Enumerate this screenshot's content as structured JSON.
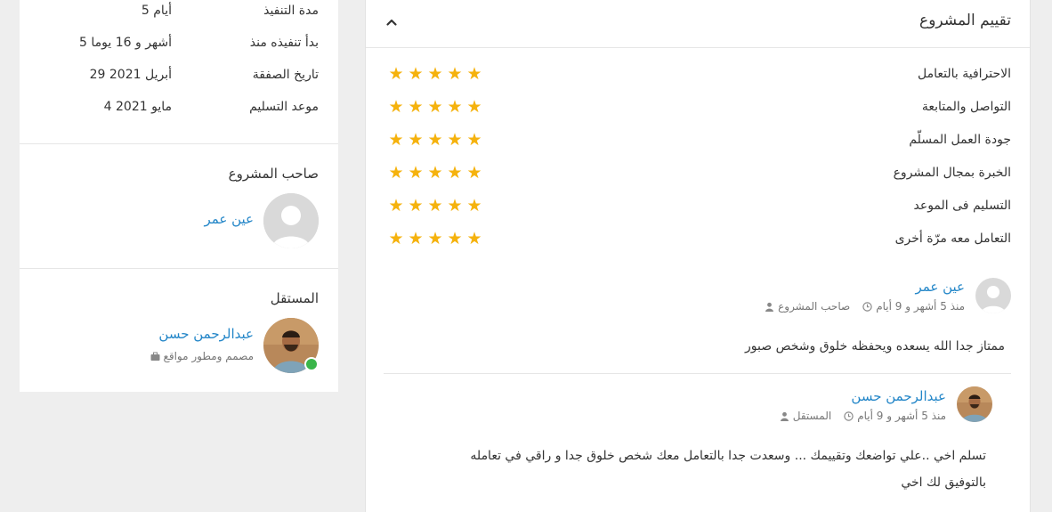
{
  "project_meta": {
    "rows": [
      {
        "label": "مدة التنفيذ",
        "value": "5 أيام"
      },
      {
        "label": "بدأ تنفيذه منذ",
        "value": "5 أشهر و 16 يوما"
      },
      {
        "label": "تاريخ الصفقة",
        "value": "29 أبريل 2021"
      },
      {
        "label": "موعد التسليم",
        "value": "4 مايو 2021"
      }
    ]
  },
  "owner": {
    "title": "صاحب المشروع",
    "name": "عين عمر"
  },
  "freelancer": {
    "title": "المستقل",
    "name": "عبدالرحمن حسن",
    "role": "مصمم ومطور مواقع",
    "online": true
  },
  "review_panel": {
    "title": "تقييم المشروع",
    "ratings": [
      {
        "label": "الاحترافية بالتعامل",
        "stars": 5
      },
      {
        "label": "التواصل والمتابعة",
        "stars": 5
      },
      {
        "label": "جودة العمل المسلّم",
        "stars": 5
      },
      {
        "label": "الخبرة بمجال المشروع",
        "stars": 5
      },
      {
        "label": "التسليم فى الموعد",
        "stars": 5
      },
      {
        "label": "التعامل معه مرّة أخرى",
        "stars": 5
      }
    ],
    "star_color": "#f5b20d",
    "comments": [
      {
        "name": "عين عمر",
        "role": "صاحب المشروع",
        "time": "منذ 5 أشهر و 9 أيام",
        "lines": [
          "ممتاز جدا الله يسعده ويحفظه خلوق وشخص صبور"
        ]
      },
      {
        "name": "عبدالرحمن حسن",
        "role": "المستقل",
        "time": "منذ 5 أشهر و 9 أيام",
        "lines": [
          "تسلم اخي ..علي تواضعك وتقييمك ... وسعدت جدا بالتعامل معك شخص خلوق جدا و راقي في تعامله",
          "بالتوفيق لك اخي"
        ]
      }
    ]
  },
  "colors": {
    "link": "#2386c8",
    "online": "#3ab54a"
  }
}
